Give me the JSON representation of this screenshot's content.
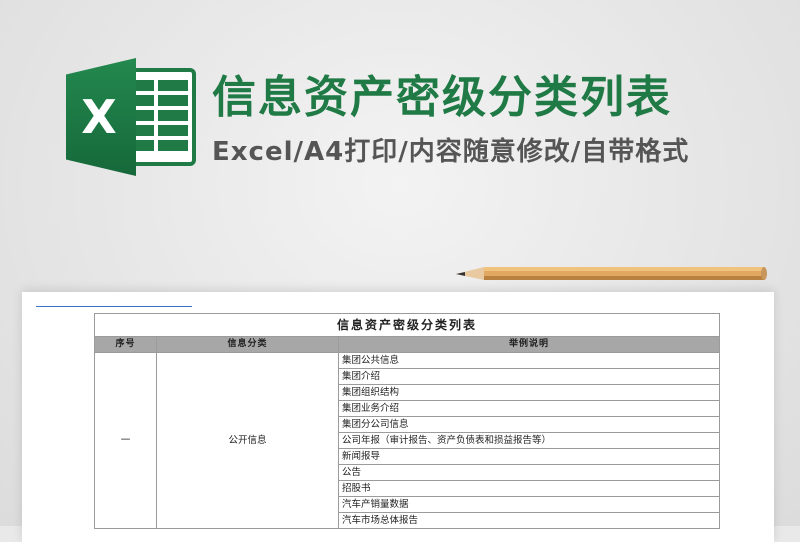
{
  "banner": {
    "title": "信息资产密级分类列表",
    "subtitle": "Excel/A4打印/内容随意修改/自带格式",
    "logo_letter": "X"
  },
  "colors": {
    "accent": "#1f7a46",
    "header_gray": "#a7a7a7"
  },
  "sheet": {
    "title": "信息资产密级分类列表",
    "columns": [
      "序号",
      "信息分类",
      "举例说明"
    ],
    "row_index": "一",
    "category": "公开信息",
    "examples": [
      "集团公共信息",
      "集团介绍",
      "集团组织结构",
      "集团业务介绍",
      "集团分公司信息",
      "公司年报（审计报告、资产负债表和损益报告等）",
      "新闻报导",
      "公告",
      "招股书",
      "汽车产销量数据",
      "汽车市场总体报告"
    ]
  }
}
